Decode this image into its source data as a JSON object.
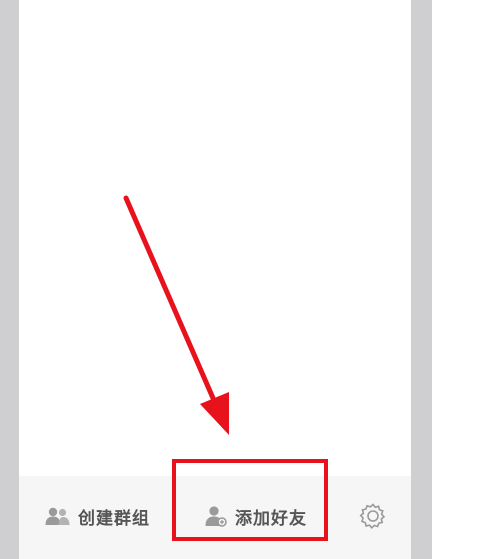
{
  "toolbar": {
    "create_group_label": "创建群组",
    "add_friend_label": "添加好友",
    "create_group_icon": "group-icon",
    "add_friend_icon": "add-user-icon",
    "settings_icon": "gear-icon"
  },
  "colors": {
    "annotation_red": "#e8121c",
    "gutter_gray": "#cfcfd1",
    "toolbar_bg": "#f6f6f6",
    "label_text": "#555555",
    "icon_gray": "#9a9a9a"
  }
}
